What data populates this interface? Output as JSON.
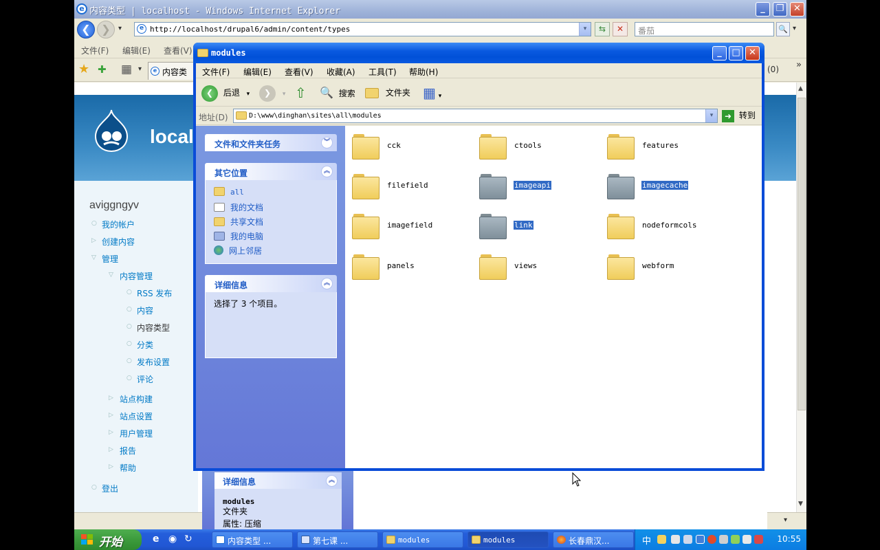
{
  "ie": {
    "title": "内容类型 | localhost - Windows Internet Explorer",
    "url": "http://localhost/drupal6/admin/content/types",
    "search_placeholder": "番茄",
    "menu": [
      "文件(F)",
      "编辑(E)",
      "查看(V)"
    ],
    "tab_label": "内容类",
    "ie_logo_glyph": "e",
    "back_glyph": "❮",
    "forward_glyph": "❯",
    "dropdown_glyph": "▾",
    "refresh_glyph": "⇆",
    "stop_glyph": "✕",
    "search_go_glyph": "🔍",
    "fav_star_glyph": "★",
    "add_fav_glyph": "✚",
    "tabs_grid_glyph": "▦",
    "tab_icon_glyph": "e",
    "windows_logo_glyph": "⊞",
    "toolbar_more_glyph": "»",
    "extra_page_text": "(0)",
    "caption_min": "_",
    "caption_max": "❐",
    "caption_close": "✕",
    "scroll_up_glyph": "▲",
    "scroll_down_glyph": "▼",
    "status_zoom": "▾"
  },
  "drupal": {
    "site_name": "local",
    "username": "aviggngyv",
    "nav": [
      {
        "label": "我的帐户",
        "marker": "○"
      },
      {
        "label": "创建内容",
        "marker": "▷"
      },
      {
        "label": "管理",
        "marker": "▽"
      },
      {
        "label": "内容管理",
        "marker": "▽"
      },
      {
        "label": "RSS 发布",
        "marker": "○"
      },
      {
        "label": "内容",
        "marker": "○"
      },
      {
        "label": "内容类型",
        "marker": "○"
      },
      {
        "label": "分类",
        "marker": "○"
      },
      {
        "label": "发布设置",
        "marker": "○"
      },
      {
        "label": "评论",
        "marker": "○"
      },
      {
        "label": "站点构建",
        "marker": "▷"
      },
      {
        "label": "站点设置",
        "marker": "▷"
      },
      {
        "label": "用户管理",
        "marker": "▷"
      },
      {
        "label": "报告",
        "marker": "▷"
      },
      {
        "label": "帮助",
        "marker": "▷"
      },
      {
        "label": "登出",
        "marker": "○"
      }
    ]
  },
  "bg_explorer": {
    "details_header": "详细信息",
    "collapse_glyph": "︽",
    "name": "modules",
    "type": "文件夹",
    "attr": "属性: 压缩"
  },
  "explorer": {
    "title": "modules",
    "menu": [
      "文件(F)",
      "编辑(E)",
      "查看(V)",
      "收藏(A)",
      "工具(T)",
      "帮助(H)"
    ],
    "back_label": "后退",
    "back_glyph": "❮",
    "forward_glyph": "❯",
    "up_glyph": "⇧",
    "dropdown_glyph": "▾",
    "search_label": "搜索",
    "search_glyph": "🔍",
    "folders_label": "文件夹",
    "views_glyph": "▦",
    "caption_min": "_",
    "caption_max": "□",
    "caption_close": "✕",
    "address_label": "地址(D)",
    "address": "D:\\www\\dinghan\\sites\\all\\modules",
    "go_glyph": "➜",
    "go_label": "转到",
    "task_header": "文件和文件夹任务",
    "places_header": "其它位置",
    "places": [
      "all",
      "我的文档",
      "共享文档",
      "我的电脑",
      "网上邻居"
    ],
    "details_header": "详细信息",
    "details_text": "选择了 3 个项目。",
    "expand_glyph": "︾",
    "collapse_glyph": "︽",
    "files": [
      {
        "name": "cck",
        "selected": false
      },
      {
        "name": "ctools",
        "selected": false
      },
      {
        "name": "features",
        "selected": false
      },
      {
        "name": "filefield",
        "selected": false
      },
      {
        "name": "imageapi",
        "selected": true
      },
      {
        "name": "imagecache",
        "selected": true
      },
      {
        "name": "imagefield",
        "selected": false
      },
      {
        "name": "link",
        "selected": true
      },
      {
        "name": "nodeformcols",
        "selected": false
      },
      {
        "name": "panels",
        "selected": false
      },
      {
        "name": "views",
        "selected": false
      },
      {
        "name": "webform",
        "selected": false
      }
    ]
  },
  "taskbar": {
    "start_label": "开始",
    "quicklaunch": [
      "e",
      "◉",
      "↻"
    ],
    "tasks": [
      {
        "label": "内容类型 ...",
        "active": false
      },
      {
        "label": "第七课  ...",
        "active": false
      },
      {
        "label": "modules",
        "active": false
      },
      {
        "label": "modules",
        "active": true
      },
      {
        "label": "长春鼎汉...",
        "active": false
      }
    ],
    "ime": "中",
    "clock": "10:55"
  },
  "colors": {
    "xp_blue": "#0a4cd8",
    "selection": "#316ac5",
    "drupal_link": "#027ac6",
    "folder_yellow": "#f0cd5b"
  }
}
